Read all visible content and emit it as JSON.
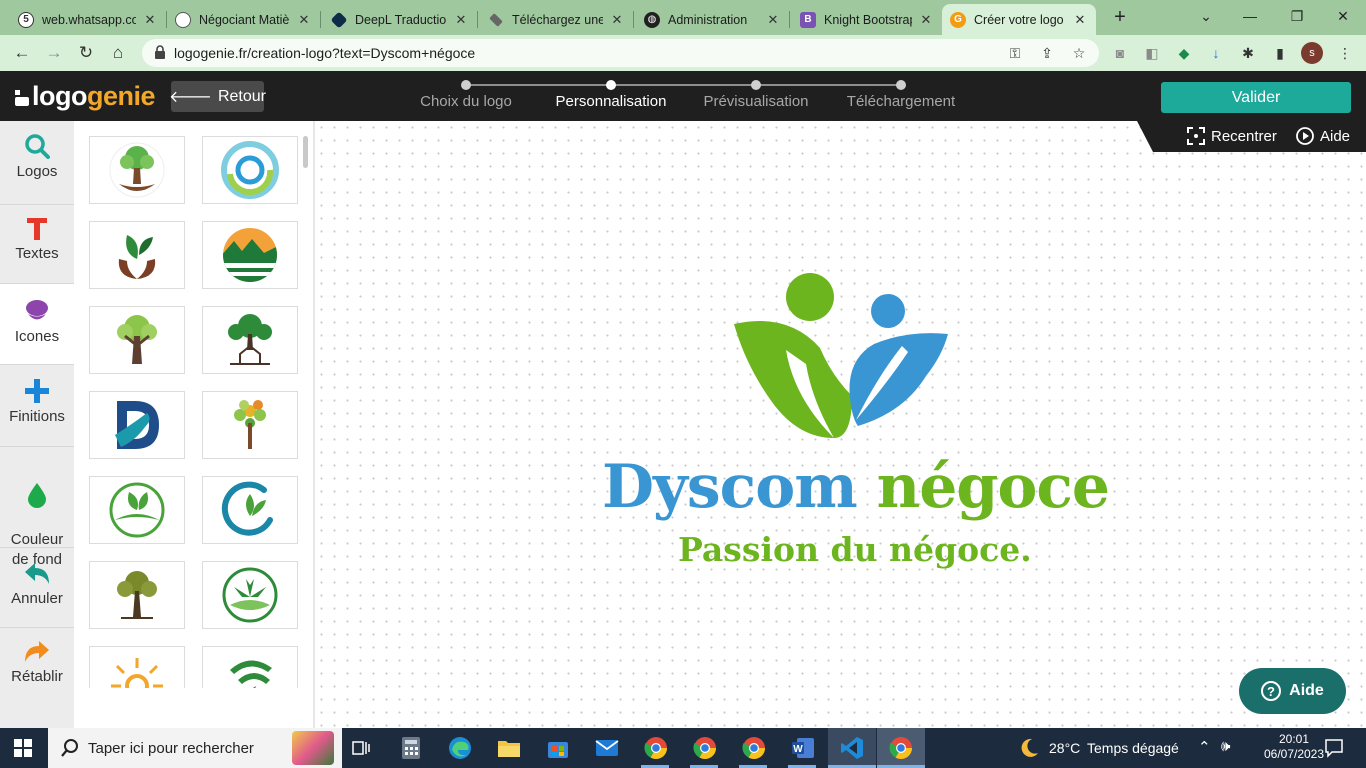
{
  "browser": {
    "tabs": [
      {
        "title": "web.whatsapp.co",
        "icon": "whatsapp-icon",
        "color": "#25d366"
      },
      {
        "title": "Négociant Matiè",
        "icon": "chatgpt-icon",
        "color": "#444444"
      },
      {
        "title": "DeepL Traduction",
        "icon": "deepl-icon",
        "color": "#0f2b46"
      },
      {
        "title": "Téléchargez une",
        "icon": "layers-icon",
        "color": "#555555"
      },
      {
        "title": "Administration",
        "icon": "globe-icon",
        "color": "#202020"
      },
      {
        "title": "Knight Bootstrap",
        "icon": "bootstrap-icon",
        "color": "#7952b3"
      },
      {
        "title": "Créer votre logo",
        "icon": "logogenie-favicon",
        "color": "#f39c12"
      }
    ],
    "url": "logogenie.fr/creation-logo?text=Dyscom+négoce",
    "profile_initial": "s"
  },
  "app": {
    "logo_part1": "logo",
    "logo_part2": "genie",
    "back_label": "Retour",
    "steps": [
      "Choix du logo",
      "Personnalisation",
      "Prévisualisation",
      "Téléchargement"
    ],
    "active_step": 1,
    "validate_label": "Valider",
    "recenter_label": "Recentrer",
    "help_label": "Aide",
    "help_float_label": "Aide"
  },
  "sidebar": {
    "items": [
      {
        "label": "Logos",
        "icon": "search-icon"
      },
      {
        "label": "Textes",
        "icon": "text-t-icon"
      },
      {
        "label": "Icones",
        "icon": "icons-icon"
      },
      {
        "label": "Finitions",
        "icon": "plus-icon"
      },
      {
        "label": "Couleur\nde fond",
        "icon": "drop-icon"
      },
      {
        "label": "Annuler",
        "icon": "undo-icon"
      },
      {
        "label": "Rétablir",
        "icon": "redo-icon"
      }
    ],
    "active_index": 2
  },
  "icon_library": [
    "tree-people-icon",
    "swirl-circle-icon",
    "leaf-hands-icon",
    "landscape-circle-icon",
    "green-tree-icon",
    "tree-house-icon",
    "letter-d-hand-icon",
    "colorful-tree-icon",
    "leaf-circle-icon",
    "swirl-leaf-icon",
    "olive-tree-icon",
    "cannabis-circle-icon",
    "sun-spiral-icon",
    "green-swoosh-icon"
  ],
  "logo_design": {
    "brand_part1": "Dyscom",
    "brand_part2": "négoce",
    "slogan": "Passion du négoce.",
    "colors": {
      "blue": "#3a96d2",
      "green": "#6cb51e"
    }
  },
  "taskbar": {
    "search_placeholder": "Taper ici pour rechercher",
    "weather_temp": "28°C",
    "weather_desc": "Temps dégagé",
    "time": "20:01",
    "date": "06/07/2023"
  }
}
